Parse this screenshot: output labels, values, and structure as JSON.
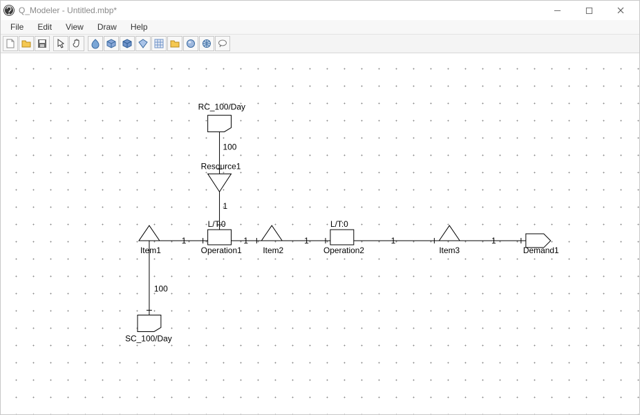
{
  "window": {
    "title": "Q_Modeler - Untitled.mbp*"
  },
  "menu": {
    "items": [
      "File",
      "Edit",
      "View",
      "Draw",
      "Help"
    ]
  },
  "toolbar": {
    "buttons": [
      "new",
      "open",
      "save",
      "pointer",
      "hand",
      "drop1",
      "box3d",
      "box3d2",
      "diamond",
      "grid",
      "folder",
      "sphere",
      "globe",
      "bubble"
    ]
  },
  "diagram": {
    "nodes": {
      "rc": {
        "label": "RC_100/Day",
        "edge_to_res": "100"
      },
      "resource": {
        "label": "Resource1",
        "edge_to_op1": "1"
      },
      "item1": {
        "label": "Item1",
        "edge_to_op1": "1",
        "edge_to_sc": "100"
      },
      "op1": {
        "label": "Operation1",
        "lt": "L/T:0",
        "edge_to_item2": "1"
      },
      "item2": {
        "label": "Item2",
        "edge_to_op2": "1"
      },
      "op2": {
        "label": "Operation2",
        "lt": "L/T:0",
        "edge_to_item3": "1"
      },
      "item3": {
        "label": "Item3",
        "edge_to_demand": "1"
      },
      "demand": {
        "label": "Demand1"
      },
      "sc": {
        "label": "SC_100/Day"
      }
    }
  }
}
